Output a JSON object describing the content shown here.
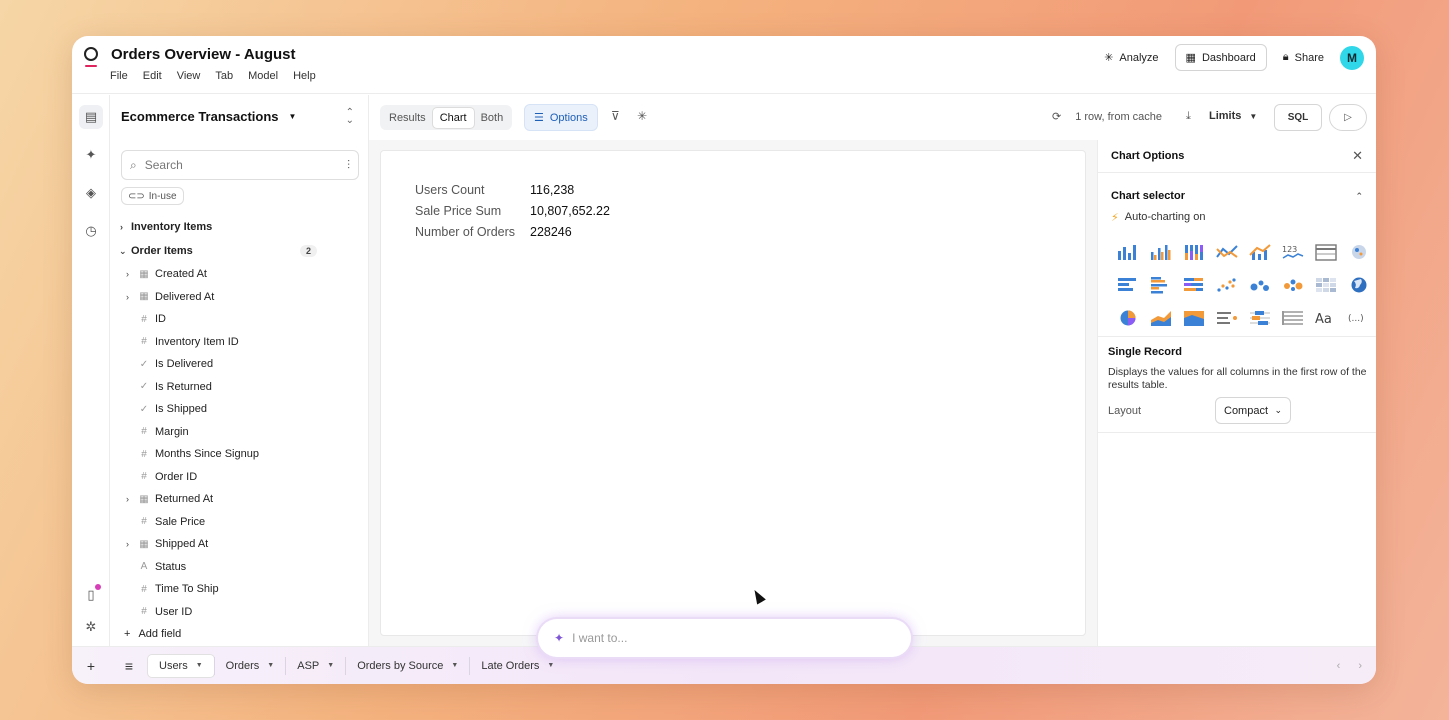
{
  "app": {
    "title": "Orders Overview - August",
    "menu": [
      "File",
      "Edit",
      "View",
      "Tab",
      "Model",
      "Help"
    ],
    "actions": {
      "analyze": "Analyze",
      "dashboard": "Dashboard",
      "share": "Share",
      "avatar": "M"
    }
  },
  "explorer": {
    "model": "Ecommerce Transactions",
    "search_placeholder": "Search",
    "chip": "In-use",
    "groups": [
      {
        "label": "Inventory Items",
        "expanded": false
      },
      {
        "label": "Order Items",
        "expanded": true,
        "count": "2"
      }
    ],
    "fields": [
      {
        "label": "Created At",
        "type": "date",
        "expandable": true
      },
      {
        "label": "Delivered At",
        "type": "date",
        "expandable": true
      },
      {
        "label": "ID",
        "type": "number"
      },
      {
        "label": "Inventory Item ID",
        "type": "number"
      },
      {
        "label": "Is Delivered",
        "type": "boolean"
      },
      {
        "label": "Is Returned",
        "type": "boolean"
      },
      {
        "label": "Is Shipped",
        "type": "boolean"
      },
      {
        "label": "Margin",
        "type": "number"
      },
      {
        "label": "Months Since Signup",
        "type": "number"
      },
      {
        "label": "Order ID",
        "type": "number"
      },
      {
        "label": "Returned At",
        "type": "date",
        "expandable": true
      },
      {
        "label": "Sale Price",
        "type": "number"
      },
      {
        "label": "Shipped At",
        "type": "date",
        "expandable": true
      },
      {
        "label": "Status",
        "type": "string"
      },
      {
        "label": "Time To Ship",
        "type": "number"
      },
      {
        "label": "User ID",
        "type": "number"
      }
    ],
    "add_field": "Add field"
  },
  "toolbar": {
    "segments": [
      "Results",
      "Chart",
      "Both"
    ],
    "active_segment": "Chart",
    "options": "Options",
    "cache_status": "1 row, from cache",
    "limits": "Limits",
    "sql": "SQL"
  },
  "record": [
    {
      "label": "Users Count",
      "value": "116,238"
    },
    {
      "label": "Sale Price Sum",
      "value": "10,807,652.22"
    },
    {
      "label": "Number of Orders",
      "value": "228246"
    }
  ],
  "chart_options": {
    "title": "Chart Options",
    "selector_title": "Chart selector",
    "auto": "Auto-charting on",
    "text_icon": "Aa",
    "more_icon": "(...)",
    "number_icon": "123",
    "single_record_title": "Single Record",
    "single_record_desc": "Displays the values for all columns in the first row of the results table.",
    "layout_label": "Layout",
    "layout_value": "Compact"
  },
  "prompt": {
    "placeholder": "I want to..."
  },
  "tabs": [
    "Users",
    "Orders",
    "ASP",
    "Orders by Source",
    "Late Orders"
  ],
  "active_tab": "Users",
  "colors": {
    "accent": "#1e5fb8",
    "bar_blue": "#3b82d6",
    "bar_orange": "#f29a3a",
    "avatar": "#2fd7e8"
  }
}
